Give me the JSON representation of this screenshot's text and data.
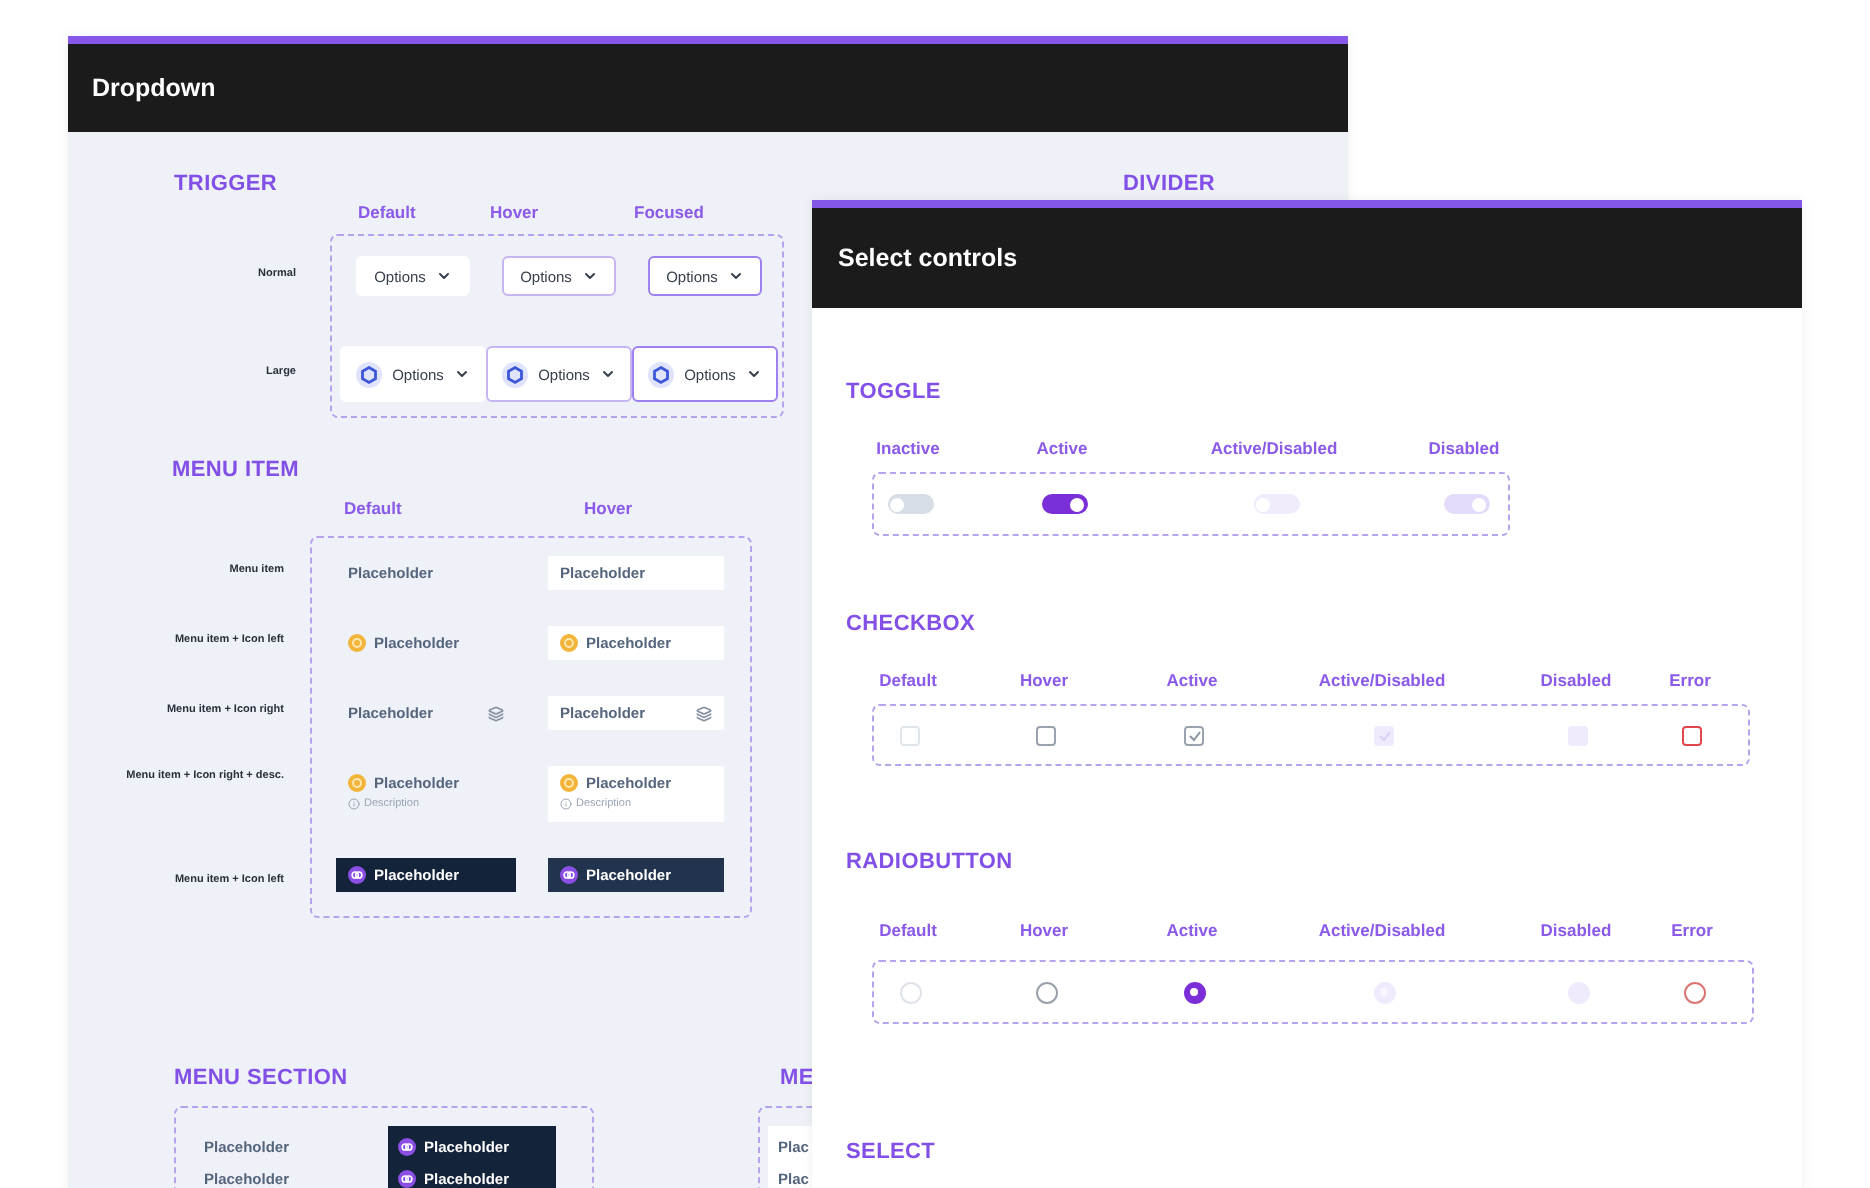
{
  "dropdown_board": {
    "title": "Dropdown",
    "trigger": {
      "heading": "TRIGGER",
      "side_heading": "DIVIDER",
      "columns": [
        "Default",
        "Hover",
        "Focused"
      ],
      "rows": [
        {
          "label": "Normal",
          "kind": "normal",
          "buttons": [
            {
              "text": "Options",
              "kind": "default"
            },
            {
              "text": "Options",
              "kind": "hover"
            },
            {
              "text": "Options",
              "kind": "focused"
            }
          ]
        },
        {
          "label": "Large",
          "kind": "large",
          "buttons": [
            {
              "text": "Options",
              "kind": "default"
            },
            {
              "text": "Options",
              "kind": "hover"
            },
            {
              "text": "Options",
              "kind": "focused"
            }
          ]
        }
      ]
    },
    "menu_item": {
      "heading": "MENU ITEM",
      "columns": [
        "Default",
        "Hover"
      ],
      "rows": [
        {
          "label": "Menu item",
          "kind": "plain",
          "items": [
            {
              "text": "Placeholder",
              "hover": false
            },
            {
              "text": "Placeholder",
              "hover": true
            }
          ]
        },
        {
          "label": "Menu item + Icon left",
          "kind": "iconleft",
          "items": [
            {
              "text": "Placeholder",
              "hover": false
            },
            {
              "text": "Placeholder",
              "hover": true
            }
          ]
        },
        {
          "label": "Menu item + Icon right",
          "kind": "iconright",
          "items": [
            {
              "text": "Placeholder",
              "hover": false
            },
            {
              "text": "Placeholder",
              "hover": true
            }
          ]
        },
        {
          "label": "Menu item + Icon right + desc.",
          "kind": "described",
          "items": [
            {
              "text": "Placeholder",
              "description": "Description",
              "hover": false
            },
            {
              "text": "Placeholder",
              "description": "Description",
              "hover": true
            }
          ]
        },
        {
          "label": "Menu item + Icon left",
          "kind": "dark",
          "items": [
            {
              "text": "Placeholder",
              "hover": false
            },
            {
              "text": "Placeholder",
              "hover": true
            }
          ]
        }
      ]
    },
    "menu_sections": [
      {
        "heading": "MENU SECTION",
        "items": [
          "Placeholder",
          "Placeholder"
        ],
        "dark_items": [
          "Placeholder",
          "Placeholder"
        ]
      },
      {
        "heading": "ME",
        "items": [
          "Plac",
          "Plac"
        ]
      }
    ]
  },
  "select_board": {
    "title": "Select controls",
    "toggle": {
      "heading": "TOGGLE",
      "items": [
        {
          "label": "Inactive",
          "on": false,
          "disabled": false
        },
        {
          "label": "Active",
          "on": true,
          "disabled": false
        },
        {
          "label": "Active/Disabled",
          "on": false,
          "disabled": true
        },
        {
          "label": "Disabled",
          "on": true,
          "disabled": true
        }
      ]
    },
    "checkbox": {
      "heading": "CHECKBOX",
      "items": [
        {
          "label": "Default",
          "kind": "default"
        },
        {
          "label": "Hover",
          "kind": "hover"
        },
        {
          "label": "Active",
          "kind": "active"
        },
        {
          "label": "Active/Disabled",
          "kind": "activedisabled"
        },
        {
          "label": "Disabled",
          "kind": "disabled"
        },
        {
          "label": "Error",
          "kind": "error"
        }
      ]
    },
    "radio": {
      "heading": "RADIOBUTTON",
      "items": [
        {
          "label": "Default",
          "kind": "default"
        },
        {
          "label": "Hover",
          "kind": "hover"
        },
        {
          "label": "Active",
          "kind": "active"
        },
        {
          "label": "Active/Disabled",
          "kind": "activedisabled"
        },
        {
          "label": "Disabled",
          "kind": "disabled"
        },
        {
          "label": "Error",
          "kind": "error"
        }
      ]
    },
    "select": {
      "heading": "SELECT"
    }
  }
}
